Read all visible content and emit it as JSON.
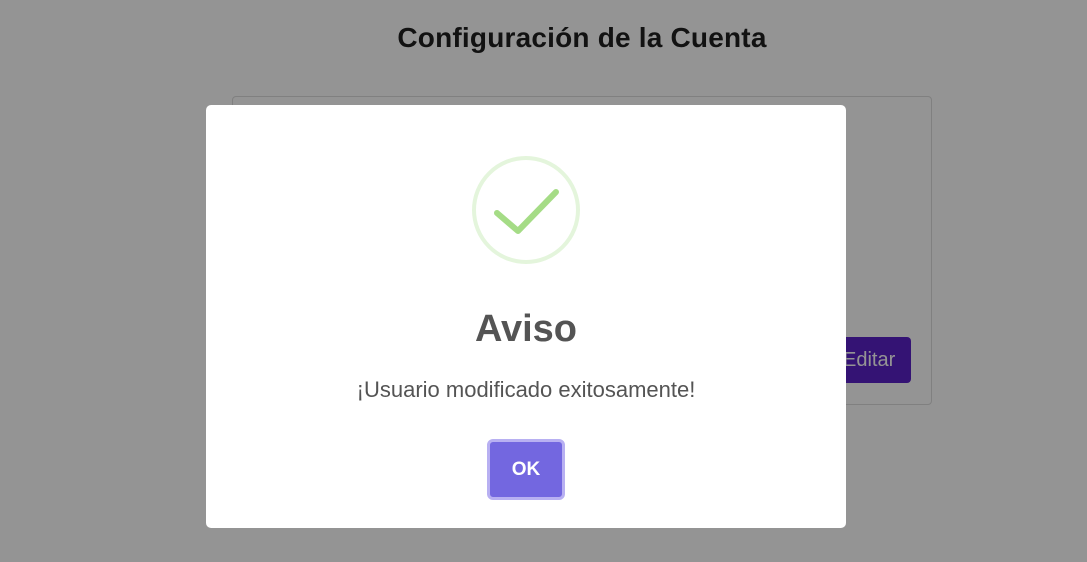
{
  "page": {
    "title": "Configuración de la Cuenta",
    "edit_button_label": "Editar"
  },
  "dialog": {
    "icon": "success-check-icon",
    "title": "Aviso",
    "message": "¡Usuario modificado exitosamente!",
    "confirm_label": "OK"
  },
  "colors": {
    "accent": "#7367e0",
    "success": "#a5dc86",
    "edit_button": "#5b21c9"
  }
}
